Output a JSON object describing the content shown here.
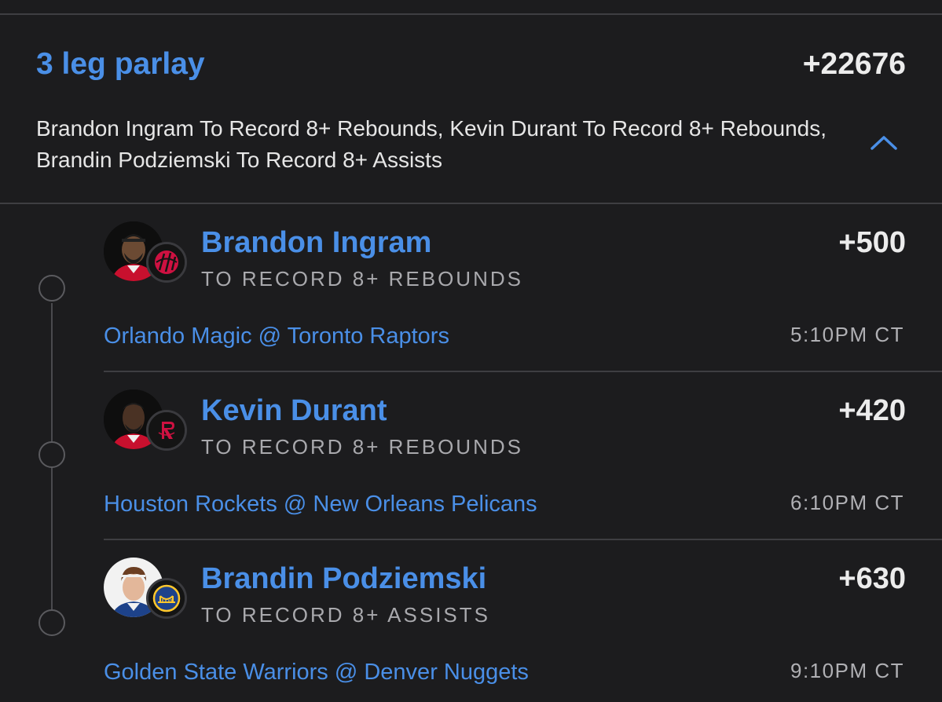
{
  "parlay": {
    "title": "3 leg parlay",
    "odds": "+22676",
    "description": "Brandon Ingram To Record 8+ Rebounds, Kevin Durant To Record 8+ Rebounds, Brandin Podziemski To Record 8+ Assists",
    "toggle_icon": "chevron-up-icon"
  },
  "legs": [
    {
      "player": "Brandon Ingram",
      "odds": "+500",
      "market": "TO RECORD 8+ REBOUNDS",
      "game": "Orlando Magic @ Toronto Raptors",
      "time": "5:10PM CT",
      "team_icon": "raptors-logo-icon",
      "team_color": "#ce1141"
    },
    {
      "player": "Kevin Durant",
      "odds": "+420",
      "market": "TO RECORD 8+ REBOUNDS",
      "game": "Houston Rockets @ New Orleans Pelicans",
      "time": "6:10PM CT",
      "team_icon": "rockets-logo-icon",
      "team_color": "#ce1141"
    },
    {
      "player": "Brandin Podziemski",
      "odds": "+630",
      "market": "TO RECORD 8+ ASSISTS",
      "game": "Golden State Warriors @ Denver Nuggets",
      "time": "9:10PM CT",
      "team_icon": "warriors-logo-icon",
      "team_color": "#1d428a"
    }
  ],
  "colors": {
    "background": "#1c1c1e",
    "accent": "#4a8fe7",
    "text_primary": "#ececec",
    "text_secondary": "#a9a9ad"
  }
}
